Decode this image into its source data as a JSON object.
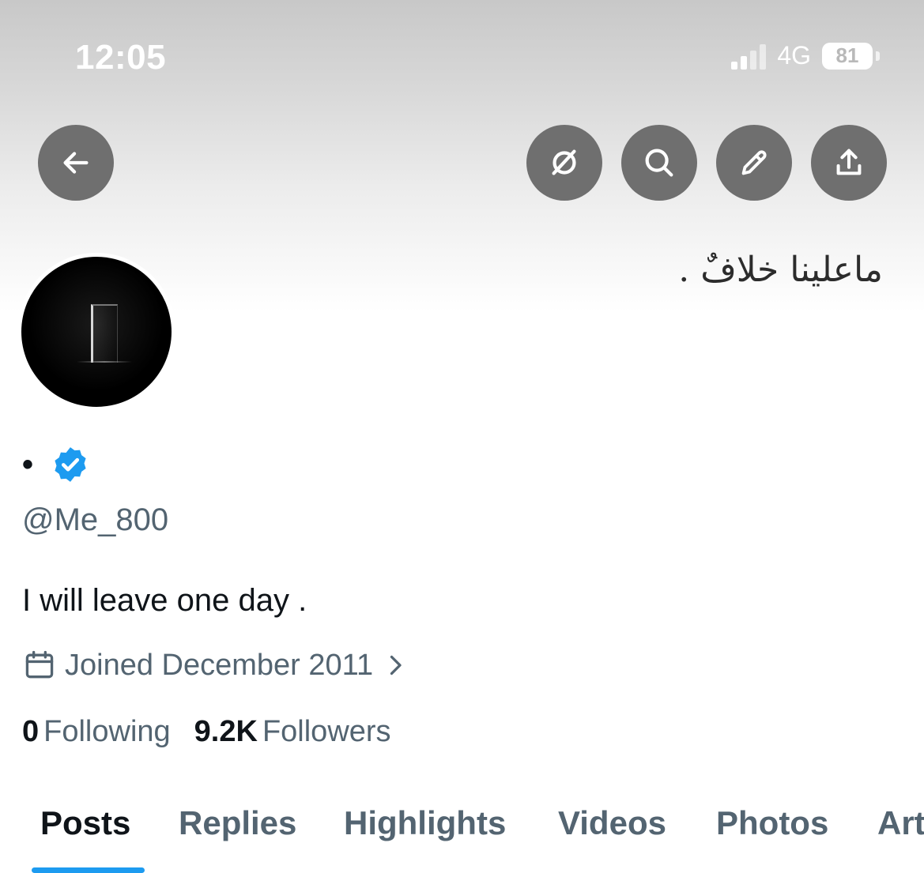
{
  "status_bar": {
    "time": "12:05",
    "network": "4G",
    "battery": "81"
  },
  "header_buttons": {
    "back": "back-arrow-icon",
    "grok": "grok-icon",
    "search": "search-icon",
    "edit": "pencil-icon",
    "share": "share-icon"
  },
  "banner": {
    "text": "ماعلينا خلافٌ ."
  },
  "profile": {
    "display_name": "•",
    "verified": true,
    "handle": "@Me_800",
    "bio": "I will leave one day .",
    "joined": "Joined December 2011",
    "following_count": "0",
    "following_label": "Following",
    "followers_count": "9.2K",
    "followers_label": "Followers"
  },
  "tabs": [
    {
      "label": "Posts",
      "active": true
    },
    {
      "label": "Replies",
      "active": false
    },
    {
      "label": "Highlights",
      "active": false
    },
    {
      "label": "Videos",
      "active": false
    },
    {
      "label": "Photos",
      "active": false
    },
    {
      "label": "Articles",
      "active": false
    }
  ],
  "colors": {
    "accent": "#1d9bf0",
    "button_bg": "#6f6f6f",
    "secondary_text": "#536471",
    "primary_text": "#0f1419"
  }
}
